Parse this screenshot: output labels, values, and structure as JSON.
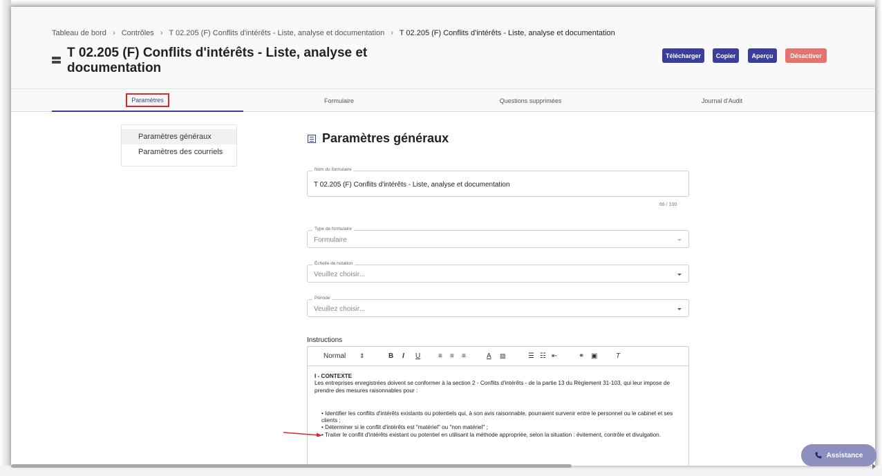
{
  "breadcrumb": {
    "items": [
      "Tableau de bord",
      "Contrôles",
      "T 02.205 (F) Conflits d'intérêts - Liste, analyse et documentation",
      "T 02.205 (F) Conflits d'intérêts - Liste, analyse et documentation"
    ],
    "separator": "›"
  },
  "header": {
    "title": "T 02.205 (F) Conflits d'intérêts - Liste, analyse et documentation",
    "buttons": {
      "download": "Télécharger",
      "copy": "Copier",
      "preview": "Aperçu",
      "deactivate": "Désactiver"
    }
  },
  "tabs": [
    {
      "label": "Paramètres",
      "active": true
    },
    {
      "label": "Formulaire"
    },
    {
      "label": "Questions supprimées"
    },
    {
      "label": "Journal d'Audit"
    }
  ],
  "sidenav": {
    "items": [
      {
        "label": "Paramètres généraux",
        "active": true
      },
      {
        "label": "Paramètres des courriels"
      }
    ]
  },
  "section": {
    "title": "Paramètres généraux"
  },
  "form": {
    "name": {
      "label": "Nom du formulaire",
      "value": "T 02.205 (F) Conflits d'intérêts - Liste, analyse et documentation",
      "counter": "66 / 100"
    },
    "type": {
      "label": "Type de formulaire",
      "value": "Formulaire"
    },
    "scale": {
      "label": "Échelle de notation",
      "placeholder": "Veuillez choisir..."
    },
    "period": {
      "label": "Période",
      "placeholder": "Veuillez choisir..."
    }
  },
  "instructions": {
    "label": "Instructions",
    "toolbar": {
      "style": "Normal"
    },
    "heading": "I - CONTEXTE",
    "intro": "Les entreprises enregistrées doivent se conformer à la section 2 - Conflits d'intérêts - de la partie 13 du Règlement 31-103, qui leur impose de prendre des mesures raisonnables pour :",
    "bullets": [
      "Identifier les conflits d'intérêts existants ou potentiels qui, à son avis raisonnable, pourraient survenir entre le personnel ou le cabinet et ses clients ;",
      "Déterminer si le conflit d'intérêts est \"matériel\" ou \"non matériel\" ;",
      "Traiter le conflit d'intérêts existant ou potentiel en utilisant la méthode appropriée, selon la situation : évitement, contrôle et divulgation."
    ]
  },
  "assistance": {
    "label": "Assistance"
  },
  "colors": {
    "primary": "#3c3f9a",
    "danger": "#e5736f",
    "highlight": "#e0262b",
    "assist": "#8d8fbd"
  }
}
